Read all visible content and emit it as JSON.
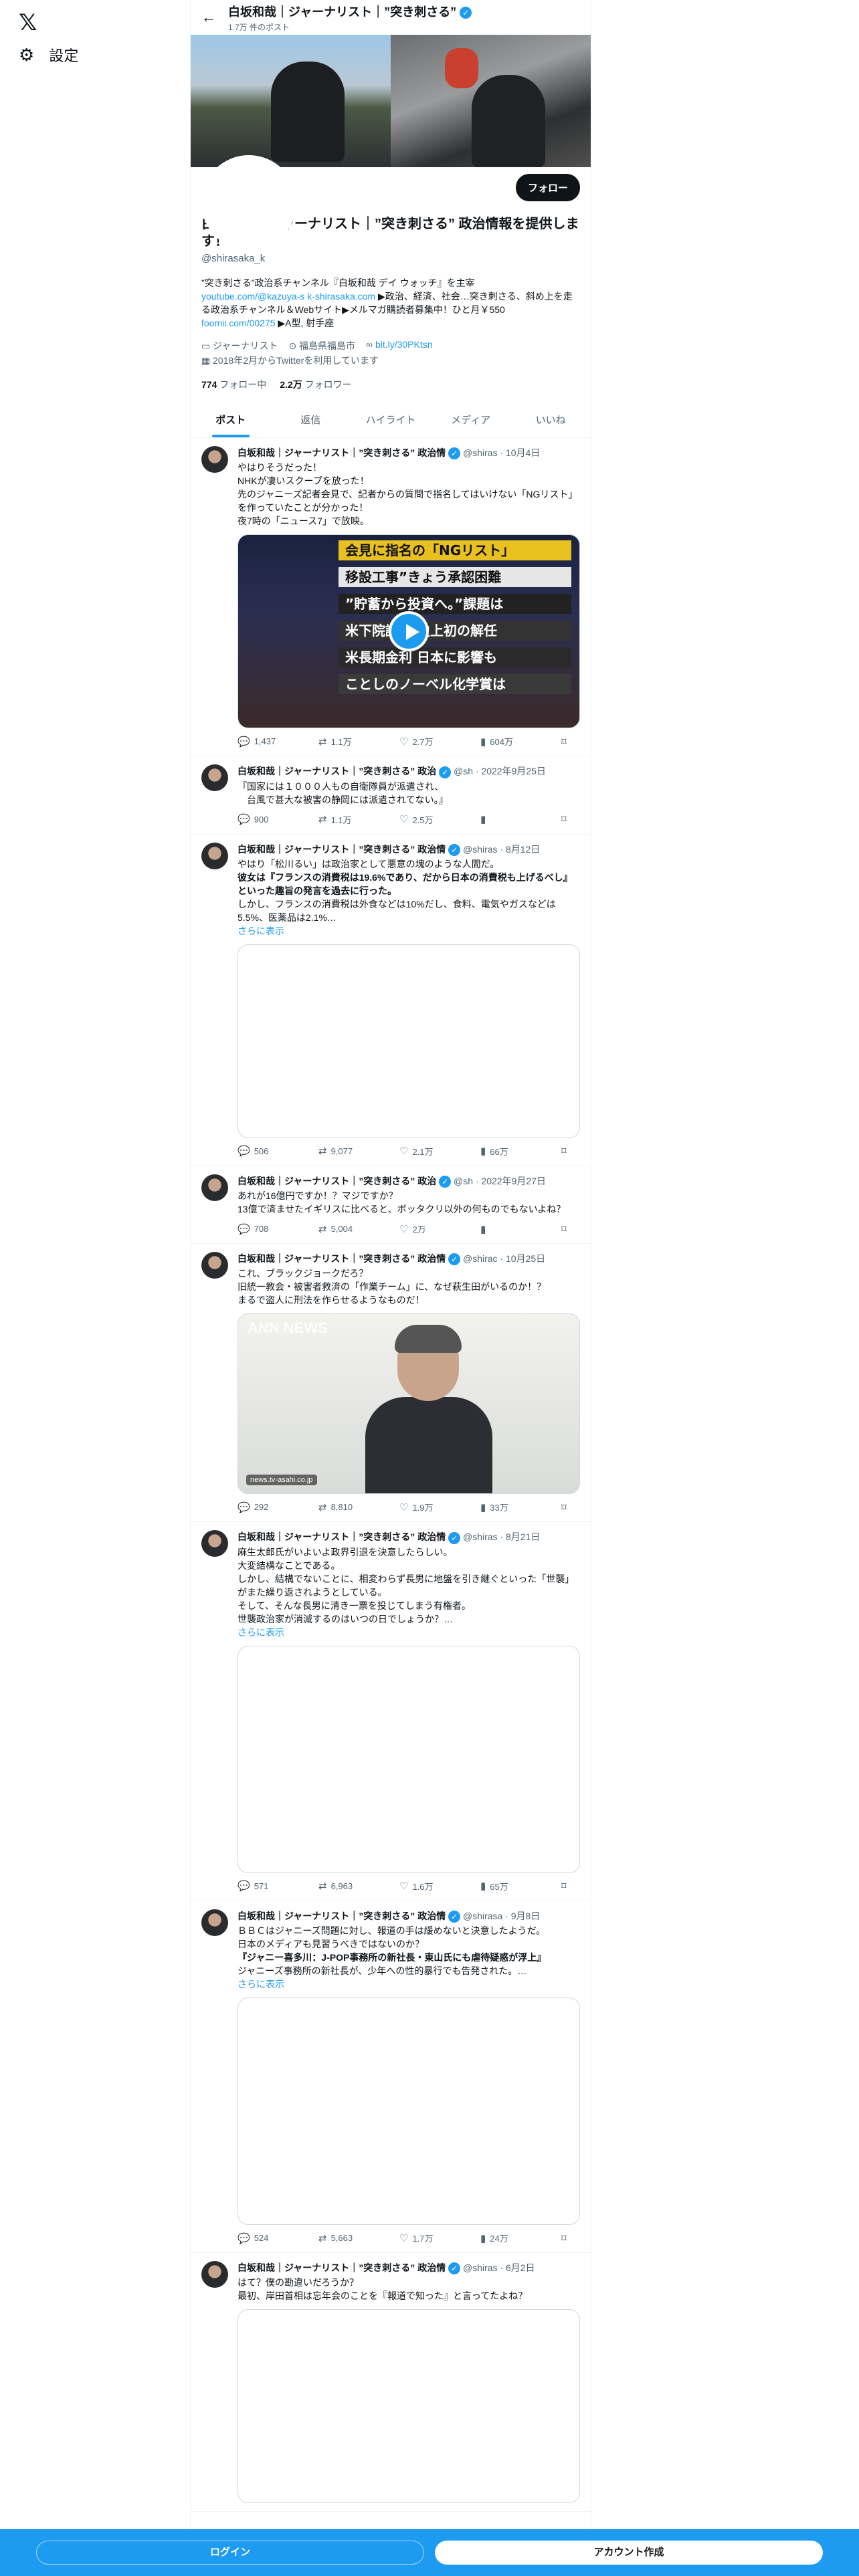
{
  "app": {
    "logo": "𝕏",
    "settings_label": "設定"
  },
  "header": {
    "name": "白坂和哉｜ジャーナリスト｜”突き刺さる”",
    "post_count": "1.7万 件のポスト"
  },
  "profile": {
    "follow_label": "フォロー",
    "name": "白坂和哉｜ジャーナリスト｜”突き刺さる” 政治情報を提供します！",
    "handle": "@shirasaka_k",
    "bio_line1": "”突き刺さる”政治系チャンネル『白坂和哉 デイ ウォッチ』を主宰",
    "bio_link1": "youtube.com/@kazuya-s",
    "bio_link2": "k-shirasaka.com",
    "bio_line2": "▶政治、経済、社会…突き刺さる、斜め上を走る政治系チャンネル＆Webサイト▶メルマガ購読者募集中！ひと月￥550",
    "bio_link3": "foomii.com/00275",
    "bio_line3": "▶A型, 射手座",
    "category": "ジャーナリスト",
    "location": "福島県福島市",
    "website": "bit.ly/30PKtsn",
    "joined": "2018年2月からTwitterを利用しています",
    "following_count": "774",
    "following_label": "フォロー中",
    "followers_count": "2.2万",
    "followers_label": "フォロワー"
  },
  "tabs": [
    "ポスト",
    "返信",
    "ハイライト",
    "メディア",
    "いいね"
  ],
  "tweets": [
    {
      "name": "白坂和哉｜ジャーナリスト｜”突き刺さる” 政治情",
      "handle": "@shiras",
      "date": "· 10月4日",
      "text": [
        "やはりそうだった！",
        "NHKが凄いスクープを放った！",
        "先のジャニーズ記者会見で、記者からの質問で指名してはいけない「NGリスト」を作っていたことが分かった！",
        "夜7時の「ニュース7」で放映。"
      ],
      "video_lines": [
        "会見に指名の「NGリスト」",
        "移設工事”きょう承認困難",
        "”貯蓄から投資へ。”課題は",
        "米下院議長 史上初の解任",
        "米長期金利 日本に影響も",
        "ことしのノーベル化学賞は"
      ],
      "replies": "1,437",
      "reposts": "1.1万",
      "likes": "2.7万",
      "views": "604万"
    },
    {
      "name": "白坂和哉｜ジャーナリスト｜”突き刺さる” 政治",
      "handle": "@sh",
      "date": "· 2022年9月25日",
      "text": [
        "『国家には１０００人もの自衛隊員が派遣され、",
        "　台風で甚大な被害の静岡には派遣されてない。』"
      ],
      "replies": "900",
      "reposts": "1.1万",
      "likes": "2.5万",
      "views": ""
    },
    {
      "name": "白坂和哉｜ジャーナリスト｜”突き刺さる” 政治情",
      "handle": "@shiras",
      "date": "· 8月12日",
      "text": [
        "やはり「松川るい」は政治家として悪意の塊のような人間だ。",
        "彼女は『フランスの消費税は19.6%であり、だから日本の消費税も上げるべし』といった趣旨の発言を過去に行った。",
        "しかし、フランスの消費税は外食などは10%だし、食料、電気やガスなどは5.5%、医薬品は2.1%…"
      ],
      "more": "さらに表示",
      "replies": "506",
      "reposts": "9,077",
      "likes": "2.1万",
      "views": "66万"
    },
    {
      "name": "白坂和哉｜ジャーナリスト｜”突き刺さる” 政治",
      "handle": "@sh",
      "date": "· 2022年9月27日",
      "text": [
        "あれが16億円ですか！？マジですか？",
        "13億で済ませたイギリスに比べると、ボッタクリ以外の何ものでもないよね？"
      ],
      "replies": "708",
      "reposts": "5,004",
      "likes": "2万",
      "views": ""
    },
    {
      "name": "白坂和哉｜ジャーナリスト｜”突き刺さる” 政治情",
      "handle": "@shirac",
      "date": "· 10月25日",
      "text": [
        "これ、ブラックジョークだろ？",
        "旧統一教会・被害者救済の「作業チーム」に、なぜ萩生田がいるのか！？",
        "まるで盗人に刑法を作らせるようなものだ！"
      ],
      "media_brand": "ANN NEWS",
      "media_source": "news.tv-asahi.co.jp",
      "replies": "292",
      "reposts": "8,810",
      "likes": "1.9万",
      "views": "33万"
    },
    {
      "name": "白坂和哉｜ジャーナリスト｜”突き刺さる” 政治情",
      "handle": "@shiras",
      "date": "· 8月21日",
      "text": [
        "麻生太郎氏がいよいよ政界引退を決意したらしい。",
        "大変結構なことである。",
        "しかし、結構でないことに、相変わらず長男に地盤を引き継ぐといった「世襲」がまた繰り返されようとしている。",
        "そして、そんな長男に清き一票を投じてしまう有権者。",
        "世襲政治家が消滅するのはいつの日でしょうか？…"
      ],
      "more": "さらに表示",
      "replies": "571",
      "reposts": "6,963",
      "likes": "1.6万",
      "views": "65万"
    },
    {
      "name": "白坂和哉｜ジャーナリスト｜”突き刺さる” 政治情",
      "handle": "@shirasa",
      "date": "· 9月8日",
      "text": [
        "ＢＢＣはジャニーズ問題に対し、報道の手は緩めないと決意したようだ。",
        "日本のメディアも見習うべきではないのか？",
        "『ジャニー喜多川：J-POP事務所の新社長・東山氏にも虐待疑惑が浮上』",
        "ジャニーズ事務所の新社長が、少年への性的暴行でも告発された。…"
      ],
      "more": "さらに表示",
      "replies": "524",
      "reposts": "5,663",
      "likes": "1.7万",
      "views": "24万"
    },
    {
      "name": "白坂和哉｜ジャーナリスト｜”突き刺さる” 政治情",
      "handle": "@shiras",
      "date": "· 6月2日",
      "text": [
        "はて？僕の勘違いだろうか？",
        "最初、岸田首相は忘年会のことを『報道で知った』と言ってたよね？"
      ],
      "replies": "",
      "reposts": "",
      "likes": "",
      "views": ""
    }
  ],
  "bottom_bar": {
    "login": "ログイン",
    "signup": "アカウント作成"
  },
  "colors": {
    "accent": "#1d9bf0",
    "text": "#0f1419",
    "muted": "#536471"
  }
}
